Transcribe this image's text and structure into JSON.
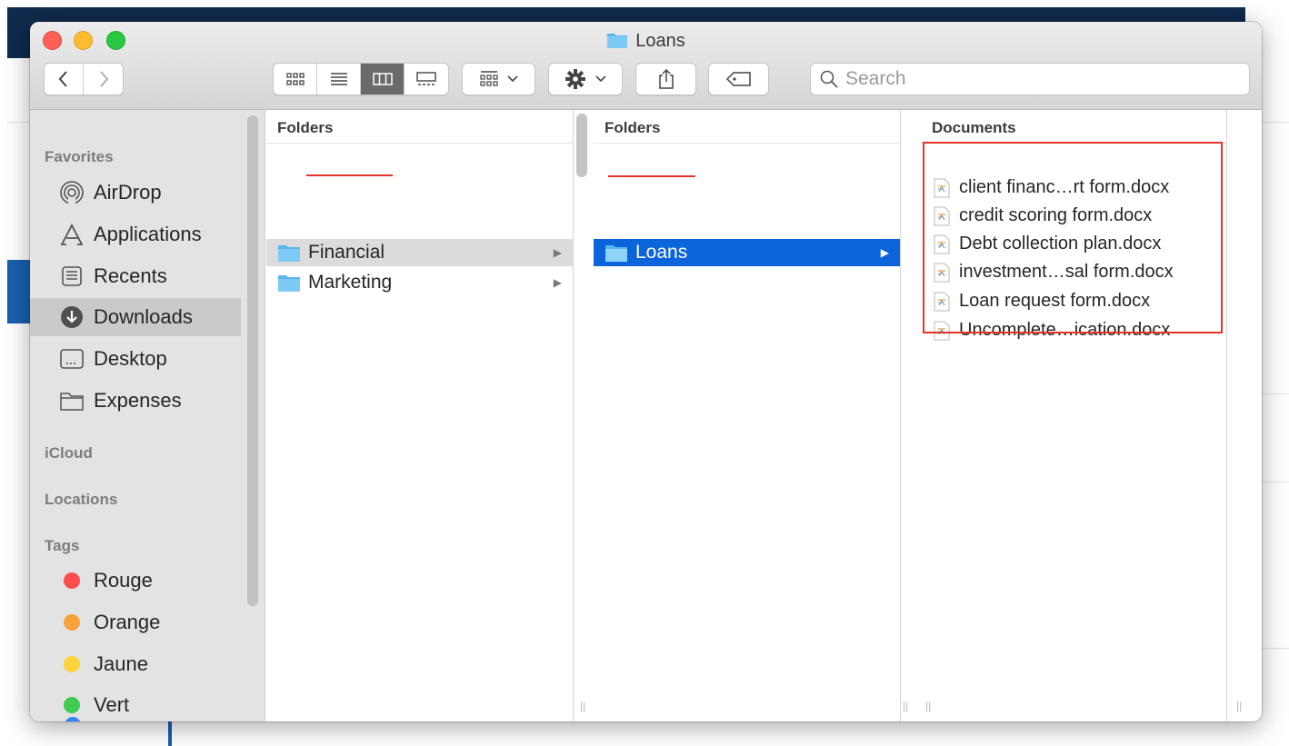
{
  "window": {
    "title": "Loans"
  },
  "toolbar": {
    "search": {
      "placeholder": "Search",
      "value": ""
    }
  },
  "sidebar": {
    "sections": {
      "favorites": "Favorites",
      "icloud": "iCloud",
      "locations": "Locations",
      "tags": "Tags"
    },
    "favorites": [
      {
        "label": "AirDrop",
        "icon": "airdrop-icon"
      },
      {
        "label": "Applications",
        "icon": "applications-icon"
      },
      {
        "label": "Recents",
        "icon": "recents-icon"
      },
      {
        "label": "Downloads",
        "icon": "downloads-icon",
        "selected": true
      },
      {
        "label": "Desktop",
        "icon": "desktop-icon"
      },
      {
        "label": "Expenses",
        "icon": "folder-icon"
      }
    ],
    "tags": [
      {
        "label": "Rouge",
        "color": "#fd4d4d"
      },
      {
        "label": "Orange",
        "color": "#f8a23c"
      },
      {
        "label": "Jaune",
        "color": "#fed33c"
      },
      {
        "label": "Vert",
        "color": "#3ecb4f"
      }
    ]
  },
  "columns": [
    {
      "header": "Folders",
      "items": [
        {
          "label": "Financial",
          "state": "selected-inactive"
        },
        {
          "label": "Marketing",
          "state": ""
        }
      ]
    },
    {
      "header": "Folders",
      "items": [
        {
          "label": "Loans",
          "state": "selected-active"
        }
      ]
    },
    {
      "header": "Documents",
      "items": [
        {
          "label": "client financ…rt form.docx"
        },
        {
          "label": "credit scoring form.docx"
        },
        {
          "label": "Debt collection plan.docx"
        },
        {
          "label": "investment…sal form.docx"
        },
        {
          "label": "Loan request form.docx"
        },
        {
          "label": "Uncomplete…ication.docx"
        }
      ]
    }
  ],
  "colors": {
    "selection_blue": "#0b64d9",
    "annotation_red": "#e5332a"
  }
}
